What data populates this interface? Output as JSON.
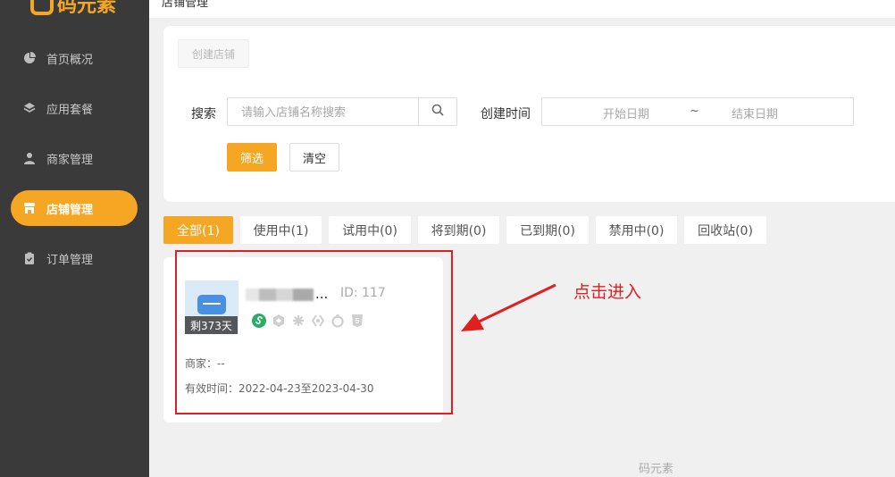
{
  "app": {
    "logo_text": "码元素"
  },
  "topbar": {
    "title": "店铺管理"
  },
  "sidebar": {
    "items": [
      {
        "label": "首页概况",
        "icon": "pie-chart-icon"
      },
      {
        "label": "应用套餐",
        "icon": "layers-icon"
      },
      {
        "label": "商家管理",
        "icon": "user-icon"
      },
      {
        "label": "店铺管理",
        "icon": "store-icon",
        "active": true
      },
      {
        "label": "订单管理",
        "icon": "clipboard-icon"
      }
    ]
  },
  "toolbar": {
    "create_label": "创建店铺"
  },
  "filters": {
    "search_label": "搜索",
    "search_placeholder": "请输入店铺名称搜索",
    "time_label": "创建时间",
    "start_placeholder": "开始日期",
    "separator": "~",
    "end_placeholder": "结束日期",
    "filter_label": "筛选",
    "clear_label": "清空"
  },
  "tabs": [
    {
      "label": "全部(1)",
      "active": true
    },
    {
      "label": "使用中(1)"
    },
    {
      "label": "试用中(0)"
    },
    {
      "label": "将到期(0)"
    },
    {
      "label": "已到期(0)"
    },
    {
      "label": "禁用中(0)"
    },
    {
      "label": "回收站(0)"
    }
  ],
  "store": {
    "name_suffix": "...",
    "id_text": "ID:  117",
    "badge": "剩373天",
    "merchant": "商家：--",
    "valid_time": "有效时间：2022-04-23至2023-04-30",
    "platform_icons": [
      "mini-program-icon",
      "douyin-icon",
      "baidu-icon",
      "kuaishou-icon",
      "alipay-icon",
      "h5-icon"
    ]
  },
  "annotation": {
    "text": "点击进入"
  },
  "footer": {
    "text": "码元素"
  },
  "colors": {
    "accent": "#f5a623",
    "sidebar_bg": "#3a3a3a",
    "annotation": "#e02020"
  }
}
